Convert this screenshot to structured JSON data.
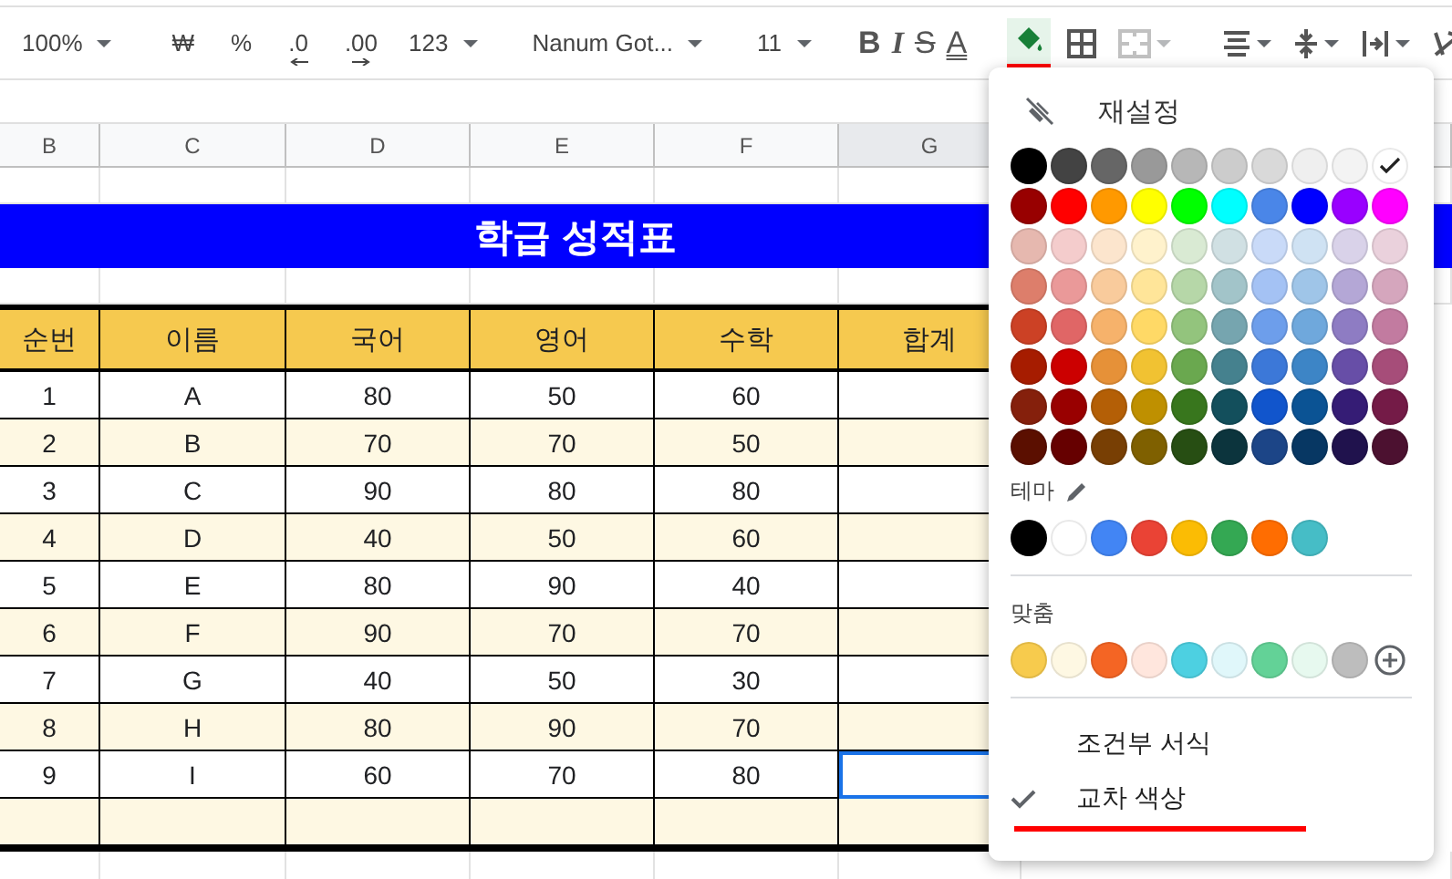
{
  "toolbar": [
    {
      "kind": "select",
      "label": "100%"
    },
    {
      "kind": "separator"
    },
    {
      "kind": "glyph",
      "label": "₩"
    },
    {
      "kind": "glyph",
      "label": "%"
    },
    {
      "kind": "decimal-decrease",
      "label": ".0"
    },
    {
      "kind": "decimal-increase",
      "label": ".00"
    },
    {
      "kind": "select",
      "label": "123"
    },
    {
      "kind": "separator"
    },
    {
      "kind": "select",
      "label": "Nanum Got..."
    },
    {
      "kind": "separator"
    },
    {
      "kind": "select",
      "label": "11"
    },
    {
      "kind": "separator"
    },
    {
      "kind": "bold",
      "label": "B"
    },
    {
      "kind": "italic",
      "label": "I"
    },
    {
      "kind": "strike",
      "label": "S"
    },
    {
      "kind": "text-color",
      "label": "A"
    },
    {
      "kind": "separator"
    },
    {
      "kind": "fill",
      "selected": true
    },
    {
      "kind": "borders"
    },
    {
      "kind": "merge",
      "disabled": true
    },
    {
      "kind": "separator"
    },
    {
      "kind": "align"
    },
    {
      "kind": "valign"
    },
    {
      "kind": "wrap"
    },
    {
      "kind": "rotate"
    }
  ],
  "column_headers": [
    {
      "label": "B",
      "selected": false
    },
    {
      "label": "C",
      "selected": false
    },
    {
      "label": "D",
      "selected": false
    },
    {
      "label": "E",
      "selected": false
    },
    {
      "label": "F",
      "selected": false
    },
    {
      "label": "G",
      "selected": true
    }
  ],
  "sheet": {
    "title": "학급 성적표",
    "columns": [
      "순번",
      "이름",
      "국어",
      "영어",
      "수학",
      "합계"
    ],
    "rows": [
      {
        "cells": [
          "1",
          "A",
          "80",
          "50",
          "60"
        ],
        "banded": false,
        "total_selected": false
      },
      {
        "cells": [
          "2",
          "B",
          "70",
          "70",
          "50"
        ],
        "banded": true,
        "total_selected": false
      },
      {
        "cells": [
          "3",
          "C",
          "90",
          "80",
          "80"
        ],
        "banded": false,
        "total_selected": false
      },
      {
        "cells": [
          "4",
          "D",
          "40",
          "50",
          "60"
        ],
        "banded": true,
        "total_selected": false
      },
      {
        "cells": [
          "5",
          "E",
          "80",
          "90",
          "40"
        ],
        "banded": false,
        "total_selected": false
      },
      {
        "cells": [
          "6",
          "F",
          "90",
          "70",
          "70"
        ],
        "banded": true,
        "total_selected": false
      },
      {
        "cells": [
          "7",
          "G",
          "40",
          "50",
          "30"
        ],
        "banded": false,
        "total_selected": false
      },
      {
        "cells": [
          "8",
          "H",
          "80",
          "90",
          "70"
        ],
        "banded": true,
        "total_selected": false
      },
      {
        "cells": [
          "9",
          "I",
          "60",
          "70",
          "80"
        ],
        "banded": false,
        "total_selected": true
      }
    ],
    "footer_banded": true
  },
  "menu": {
    "reset": "재설정",
    "palette_rows": [
      [
        {
          "color": "#000000",
          "selected": false
        },
        {
          "color": "#434343",
          "selected": false
        },
        {
          "color": "#666666",
          "selected": false
        },
        {
          "color": "#999999",
          "selected": false
        },
        {
          "color": "#b7b7b7",
          "selected": false
        },
        {
          "color": "#cccccc",
          "selected": false
        },
        {
          "color": "#d9d9d9",
          "selected": false
        },
        {
          "color": "#efefef",
          "selected": false
        },
        {
          "color": "#f3f3f3",
          "selected": false
        },
        {
          "color": "#ffffff",
          "selected": true
        }
      ],
      [
        {
          "color": "#980000",
          "selected": false
        },
        {
          "color": "#ff0000",
          "selected": false
        },
        {
          "color": "#ff9900",
          "selected": false
        },
        {
          "color": "#ffff00",
          "selected": false
        },
        {
          "color": "#00ff00",
          "selected": false
        },
        {
          "color": "#00ffff",
          "selected": false
        },
        {
          "color": "#4a86e8",
          "selected": false
        },
        {
          "color": "#0000ff",
          "selected": false
        },
        {
          "color": "#9900ff",
          "selected": false
        },
        {
          "color": "#ff00ff",
          "selected": false
        }
      ],
      [
        {
          "color": "#e6b8af",
          "selected": false
        },
        {
          "color": "#f4cccc",
          "selected": false
        },
        {
          "color": "#fce5cd",
          "selected": false
        },
        {
          "color": "#fff2cc",
          "selected": false
        },
        {
          "color": "#d9ead3",
          "selected": false
        },
        {
          "color": "#d0e0e3",
          "selected": false
        },
        {
          "color": "#c9daf8",
          "selected": false
        },
        {
          "color": "#cfe2f3",
          "selected": false
        },
        {
          "color": "#d9d2e9",
          "selected": false
        },
        {
          "color": "#ead1dc",
          "selected": false
        }
      ],
      [
        {
          "color": "#dd7e6b",
          "selected": false
        },
        {
          "color": "#ea9999",
          "selected": false
        },
        {
          "color": "#f9cb9c",
          "selected": false
        },
        {
          "color": "#ffe599",
          "selected": false
        },
        {
          "color": "#b6d7a8",
          "selected": false
        },
        {
          "color": "#a2c4c9",
          "selected": false
        },
        {
          "color": "#a4c2f4",
          "selected": false
        },
        {
          "color": "#9fc5e8",
          "selected": false
        },
        {
          "color": "#b4a7d6",
          "selected": false
        },
        {
          "color": "#d5a6bd",
          "selected": false
        }
      ],
      [
        {
          "color": "#cc4125",
          "selected": false
        },
        {
          "color": "#e06666",
          "selected": false
        },
        {
          "color": "#f6b26b",
          "selected": false
        },
        {
          "color": "#ffd966",
          "selected": false
        },
        {
          "color": "#93c47d",
          "selected": false
        },
        {
          "color": "#76a5af",
          "selected": false
        },
        {
          "color": "#6d9eeb",
          "selected": false
        },
        {
          "color": "#6fa8dc",
          "selected": false
        },
        {
          "color": "#8e7cc3",
          "selected": false
        },
        {
          "color": "#c27ba0",
          "selected": false
        }
      ],
      [
        {
          "color": "#a61c00",
          "selected": false
        },
        {
          "color": "#cc0000",
          "selected": false
        },
        {
          "color": "#e69138",
          "selected": false
        },
        {
          "color": "#f1c232",
          "selected": false
        },
        {
          "color": "#6aa84f",
          "selected": false
        },
        {
          "color": "#45818e",
          "selected": false
        },
        {
          "color": "#3c78d8",
          "selected": false
        },
        {
          "color": "#3d85c6",
          "selected": false
        },
        {
          "color": "#674ea7",
          "selected": false
        },
        {
          "color": "#a64d79",
          "selected": false
        }
      ],
      [
        {
          "color": "#85200c",
          "selected": false
        },
        {
          "color": "#990000",
          "selected": false
        },
        {
          "color": "#b45f06",
          "selected": false
        },
        {
          "color": "#bf9000",
          "selected": false
        },
        {
          "color": "#38761d",
          "selected": false
        },
        {
          "color": "#134f5c",
          "selected": false
        },
        {
          "color": "#1155cc",
          "selected": false
        },
        {
          "color": "#0b5394",
          "selected": false
        },
        {
          "color": "#351c75",
          "selected": false
        },
        {
          "color": "#741b47",
          "selected": false
        }
      ],
      [
        {
          "color": "#5b0f00",
          "selected": false
        },
        {
          "color": "#660000",
          "selected": false
        },
        {
          "color": "#783f04",
          "selected": false
        },
        {
          "color": "#7f6000",
          "selected": false
        },
        {
          "color": "#274e13",
          "selected": false
        },
        {
          "color": "#0c343d",
          "selected": false
        },
        {
          "color": "#1c4587",
          "selected": false
        },
        {
          "color": "#073763",
          "selected": false
        },
        {
          "color": "#20124d",
          "selected": false
        },
        {
          "color": "#4c1130",
          "selected": false
        }
      ]
    ],
    "theme_label": "테마",
    "theme": [
      {
        "color": "#000000",
        "selected": false
      },
      {
        "color": "#ffffff",
        "selected": false
      },
      {
        "color": "#4285f4",
        "selected": false
      },
      {
        "color": "#ea4335",
        "selected": false
      },
      {
        "color": "#fbbc04",
        "selected": false
      },
      {
        "color": "#34a853",
        "selected": false
      },
      {
        "color": "#ff6d01",
        "selected": false
      },
      {
        "color": "#46bdc6",
        "selected": false
      }
    ],
    "custom_label": "맞춤",
    "custom": [
      {
        "color": "#f7cb4d",
        "selected": false
      },
      {
        "color": "#fef8e3",
        "selected": false
      },
      {
        "color": "#f46524",
        "selected": false
      },
      {
        "color": "#ffe6dd",
        "selected": false
      },
      {
        "color": "#4dd0e1",
        "selected": false
      },
      {
        "color": "#e0f7fa",
        "selected": false
      },
      {
        "color": "#63d297",
        "selected": false
      },
      {
        "color": "#e7f9ef",
        "selected": false
      },
      {
        "color": "#bdbdbd",
        "selected": false
      }
    ],
    "options": [
      {
        "label": "조건부 서식",
        "checked": false,
        "highlighted": false
      },
      {
        "label": "교차 색상",
        "checked": true,
        "highlighted": true
      }
    ]
  }
}
